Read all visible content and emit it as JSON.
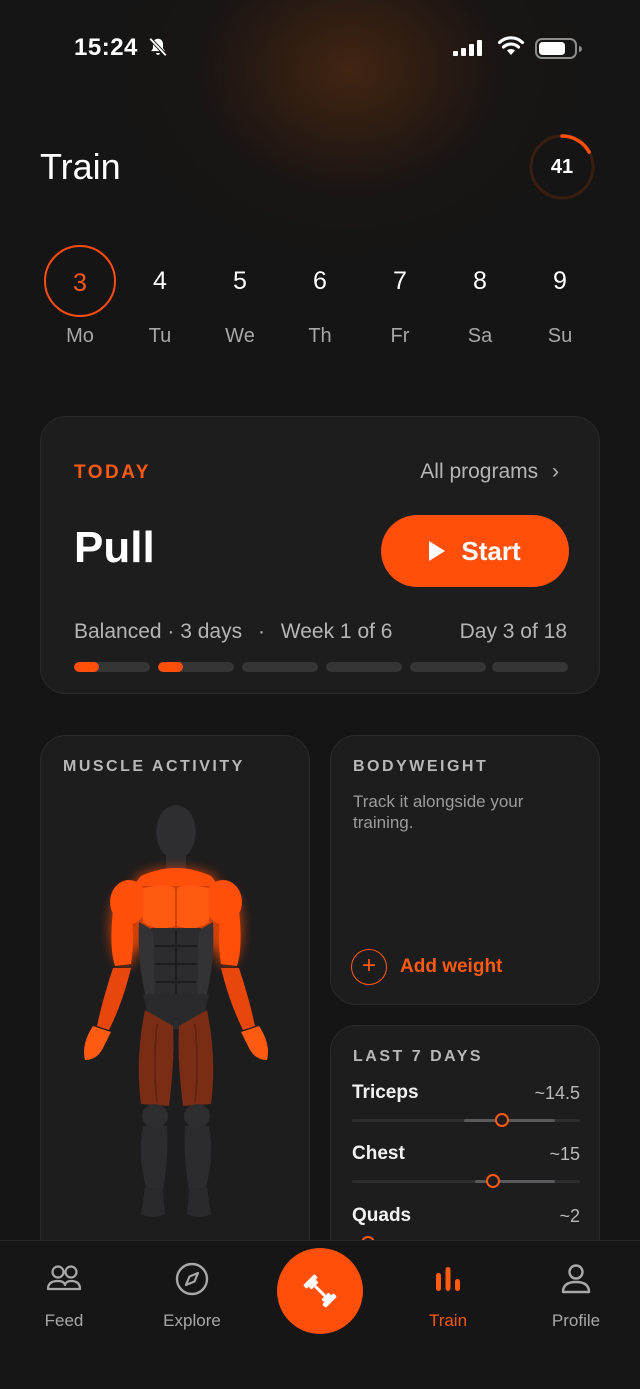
{
  "status_bar": {
    "time": "15:24"
  },
  "header": {
    "title": "Train",
    "streak_count": "41",
    "streak_progress": 0.17
  },
  "week": {
    "days": [
      {
        "num": "3",
        "label": "Mo",
        "selected": true
      },
      {
        "num": "4",
        "label": "Tu"
      },
      {
        "num": "5",
        "label": "We"
      },
      {
        "num": "6",
        "label": "Th"
      },
      {
        "num": "7",
        "label": "Fr"
      },
      {
        "num": "8",
        "label": "Sa"
      },
      {
        "num": "9",
        "label": "Su"
      }
    ]
  },
  "today": {
    "label": "TODAY",
    "all_programs": "All programs",
    "workout": "Pull",
    "start": "Start",
    "program": "Balanced · 3 days",
    "separator": "·",
    "week": "Week 1 of 6",
    "day": "Day 3 of 18",
    "progress_segments": [
      0.33,
      0.33,
      0,
      0,
      0,
      0
    ]
  },
  "muscle_activity": {
    "title": "MUSCLE ACTIVITY"
  },
  "bodyweight": {
    "title": "BODYWEIGHT",
    "description": "Track it alongside your training.",
    "add_label": "Add weight"
  },
  "last7": {
    "title": "LAST 7 DAYS",
    "muscles": [
      {
        "name": "Triceps",
        "value": "~14.5",
        "position": 0.66,
        "band": [
          0.49,
          0.89
        ]
      },
      {
        "name": "Chest",
        "value": "~15",
        "position": 0.62,
        "band": [
          0.54,
          0.89
        ]
      },
      {
        "name": "Quads",
        "value": "~2",
        "position": 0.07,
        "band": [
          0.0,
          0.3
        ]
      }
    ]
  },
  "tabbar": {
    "tabs": [
      {
        "label": "Feed",
        "icon": "people-icon"
      },
      {
        "label": "Explore",
        "icon": "compass-icon"
      },
      {
        "label": "Train",
        "icon": "bar-chart-icon",
        "active": true
      },
      {
        "label": "Profile",
        "icon": "person-icon"
      }
    ],
    "center_icon": "dumbbell-icon"
  },
  "colors": {
    "accent": "#ff4f0a",
    "background": "#151515",
    "card": "#1d1d1e"
  }
}
